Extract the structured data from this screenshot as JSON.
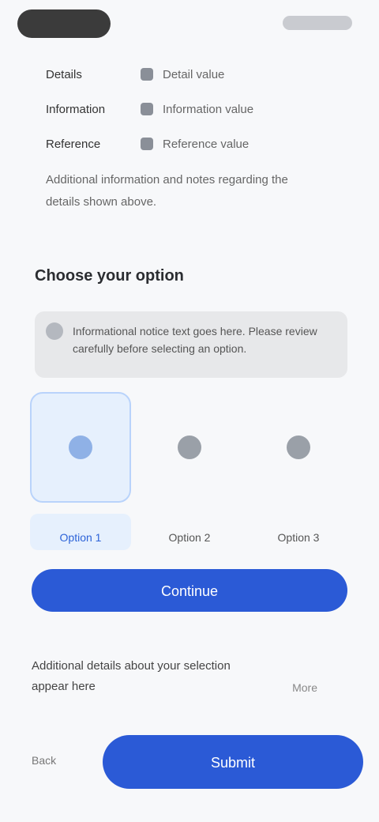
{
  "status": {
    "left_pill": "",
    "right_time": ""
  },
  "info": {
    "rows": [
      {
        "label": "Details",
        "value": "Detail value"
      },
      {
        "label": "Information",
        "value": "Information value"
      },
      {
        "label": "Reference",
        "value": "Reference value"
      }
    ],
    "note": "Additional information and notes regarding the details shown above."
  },
  "section": {
    "title": "Choose your option"
  },
  "notice": {
    "text": "Informational notice text goes here. Please review carefully before selecting an option."
  },
  "options": [
    {
      "label": "Option 1",
      "selected": true
    },
    {
      "label": "Option 2",
      "selected": false
    },
    {
      "label": "Option 3",
      "selected": false
    }
  ],
  "primary_button": {
    "label": "Continue"
  },
  "bottom": {
    "text": "Additional details about your selection appear here",
    "right": "More"
  },
  "footer": {
    "left": "Back",
    "button": "Submit"
  },
  "colors": {
    "accent": "#2b5ad6",
    "selected_bg": "#e6f0fd"
  }
}
